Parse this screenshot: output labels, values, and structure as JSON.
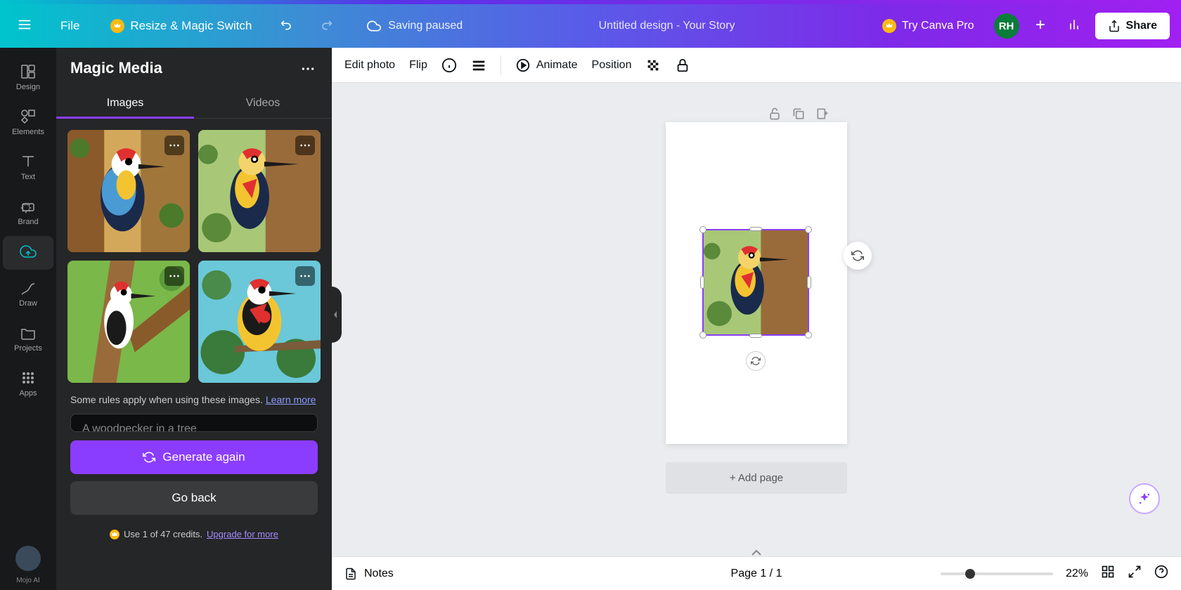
{
  "header": {
    "file": "File",
    "resize": "Resize & Magic Switch",
    "saving": "Saving paused",
    "doc_title": "Untitled design - Your Story",
    "try_pro": "Try Canva Pro",
    "avatar": "RH",
    "share": "Share"
  },
  "sidebar": {
    "items": [
      {
        "label": "Design",
        "icon": "design"
      },
      {
        "label": "Elements",
        "icon": "elements"
      },
      {
        "label": "Text",
        "icon": "text"
      },
      {
        "label": "Brand",
        "icon": "brand"
      },
      {
        "label": "",
        "icon": "uploads"
      },
      {
        "label": "Draw",
        "icon": "draw"
      },
      {
        "label": "Projects",
        "icon": "projects"
      },
      {
        "label": "Apps",
        "icon": "apps"
      }
    ],
    "mojo": "Mojo AI"
  },
  "panel": {
    "title": "Magic Media",
    "tabs": {
      "images": "Images",
      "videos": "Videos"
    },
    "rules_text": "Some rules apply when using these images. ",
    "rules_link": "Learn more",
    "prompt": "A woodpecker in a tree",
    "generate": "Generate again",
    "back": "Go back",
    "credits_text": "Use 1 of 47 credits. ",
    "credits_link": "Upgrade for more"
  },
  "toolbar": {
    "edit_photo": "Edit photo",
    "flip": "Flip",
    "animate": "Animate",
    "position": "Position"
  },
  "canvas": {
    "add_page": "+ Add page"
  },
  "footer": {
    "notes": "Notes",
    "page": "Page 1 / 1",
    "zoom": "22%"
  }
}
